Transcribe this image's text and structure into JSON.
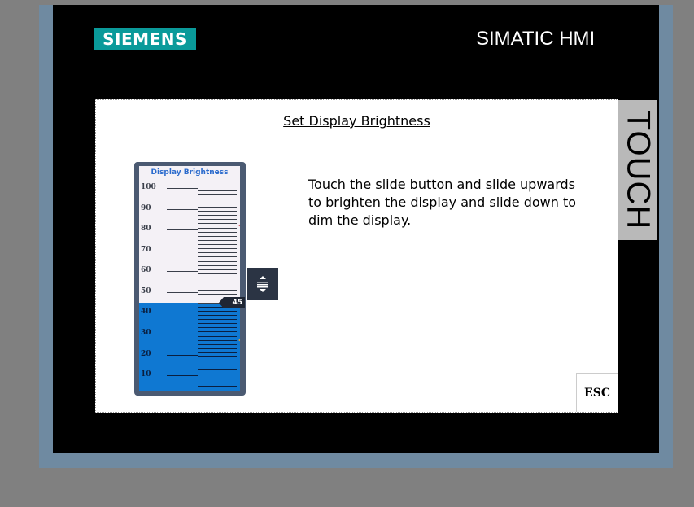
{
  "header": {
    "logo_text": "SIEMENS",
    "brand_text": "SIMATIC HMI",
    "side_label": "TOUCH"
  },
  "colors": {
    "logo_bg": "#0a9a9a",
    "bezel": "#000000",
    "frame": "#6f8aa1",
    "slider_fill": "#0f78d2",
    "slider_bg": "#f4f1f6"
  },
  "screen": {
    "title": "Set Display Brightness",
    "instructions": "Touch the slide button and slide upwards to brighten the display and slide down to dim the display.",
    "esc_label": "ESC"
  },
  "slider": {
    "label": "Display Brightness",
    "min": 5,
    "max": 100,
    "value": 45,
    "value_text": "45",
    "upper_marker": 82,
    "lower_marker": 27,
    "ticks": [
      "100",
      "90",
      "80",
      "70",
      "60",
      "50",
      "40",
      "30",
      "20",
      "10"
    ],
    "handle_icon": "slider-handle-icon"
  }
}
